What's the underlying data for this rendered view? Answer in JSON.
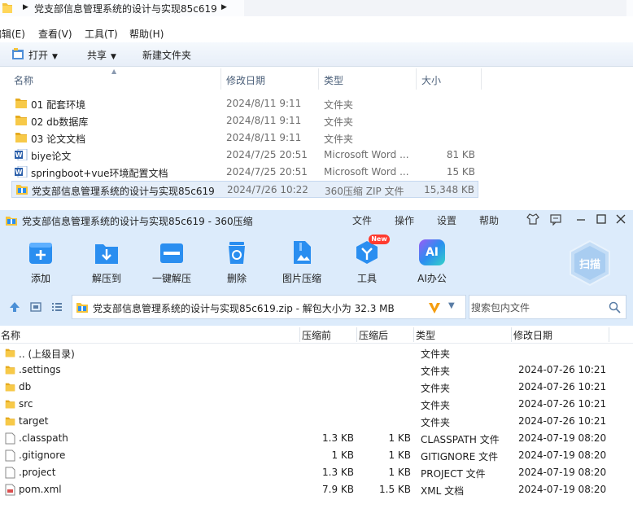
{
  "explorer": {
    "address": {
      "path": "党支部信息管理系统的设计与实现85c619"
    },
    "menu": [
      "编辑(E)",
      "查看(V)",
      "工具(T)",
      "帮助(H)"
    ],
    "toolbar": {
      "open": "打开",
      "share": "共享",
      "new_folder": "新建文件夹"
    },
    "columns": {
      "name": "名称",
      "date": "修改日期",
      "type": "类型",
      "size": "大小"
    },
    "files": [
      {
        "name": "01 配套环境",
        "date": "2024/8/11 9:11",
        "type": "文件夹",
        "size": "",
        "icon": "folder-icon"
      },
      {
        "name": "02 db数据库",
        "date": "2024/8/11 9:11",
        "type": "文件夹",
        "size": "",
        "icon": "folder-icon"
      },
      {
        "name": "03 论文文档",
        "date": "2024/8/11 9:11",
        "type": "文件夹",
        "size": "",
        "icon": "folder-icon"
      },
      {
        "name": "biye论文",
        "date": "2024/7/25 20:51",
        "type": "Microsoft Word ...",
        "size": "81 KB",
        "icon": "word-doc-icon"
      },
      {
        "name": "springboot+vue环境配置文档",
        "date": "2024/7/25 20:51",
        "type": "Microsoft Word ...",
        "size": "15 KB",
        "icon": "word-doc-icon"
      },
      {
        "name": "党支部信息管理系统的设计与实现85c619",
        "date": "2024/7/26 10:22",
        "type": "360压缩 ZIP 文件",
        "size": "15,348 KB",
        "icon": "zip-icon",
        "selected": true
      }
    ]
  },
  "zip": {
    "title": "党支部信息管理系统的设计与实现85c619 - 360压缩",
    "menu": [
      "文件",
      "操作",
      "设置",
      "帮助"
    ],
    "tools": [
      {
        "label": "添加",
        "icon": "add-icon"
      },
      {
        "label": "解压到",
        "icon": "extract-to-icon"
      },
      {
        "label": "一键解压",
        "icon": "one-click-extract-icon"
      },
      {
        "label": "删除",
        "icon": "delete-icon"
      },
      {
        "label": "图片压缩",
        "icon": "image-compress-icon"
      },
      {
        "label": "工具",
        "icon": "tools-icon"
      },
      {
        "label": "AI办公",
        "icon": "ai-office-icon"
      }
    ],
    "new_badge": "New",
    "scan_label": "扫描",
    "ai_label": "AI",
    "path": "党支部信息管理系统的设计与实现85c619.zip - 解包大小为 32.3 MB",
    "search_placeholder": "搜索包内文件",
    "columns": {
      "name": "名称",
      "size": "压缩前",
      "packed": "压缩后",
      "type": "类型",
      "date": "修改日期"
    },
    "files": [
      {
        "name": ".. (上级目录)",
        "size": "",
        "packed": "",
        "type": "文件夹",
        "date": "",
        "icon": "folder-icon"
      },
      {
        "name": ".settings",
        "size": "",
        "packed": "",
        "type": "文件夹",
        "date": "2024-07-26 10:21",
        "icon": "folder-icon"
      },
      {
        "name": "db",
        "size": "",
        "packed": "",
        "type": "文件夹",
        "date": "2024-07-26 10:21",
        "icon": "folder-icon"
      },
      {
        "name": "src",
        "size": "",
        "packed": "",
        "type": "文件夹",
        "date": "2024-07-26 10:21",
        "icon": "folder-icon"
      },
      {
        "name": "target",
        "size": "",
        "packed": "",
        "type": "文件夹",
        "date": "2024-07-26 10:21",
        "icon": "folder-icon"
      },
      {
        "name": ".classpath",
        "size": "1.3 KB",
        "packed": "1 KB",
        "type": "CLASSPATH 文件",
        "date": "2024-07-19 08:20",
        "icon": "file-icon"
      },
      {
        "name": ".gitignore",
        "size": "1 KB",
        "packed": "1 KB",
        "type": "GITIGNORE 文件",
        "date": "2024-07-19 08:20",
        "icon": "file-icon"
      },
      {
        "name": ".project",
        "size": "1.3 KB",
        "packed": "1 KB",
        "type": "PROJECT 文件",
        "date": "2024-07-19 08:20",
        "icon": "file-icon"
      },
      {
        "name": "pom.xml",
        "size": "7.9 KB",
        "packed": "1.5 KB",
        "type": "XML 文档",
        "date": "2024-07-19 08:20",
        "icon": "xml-file-icon"
      }
    ]
  },
  "colors": {
    "folder": "#f4c33c",
    "accent_blue": "#2a8ef0",
    "zip_header": "#dcebfb",
    "selected_row": "#e5eef9"
  }
}
